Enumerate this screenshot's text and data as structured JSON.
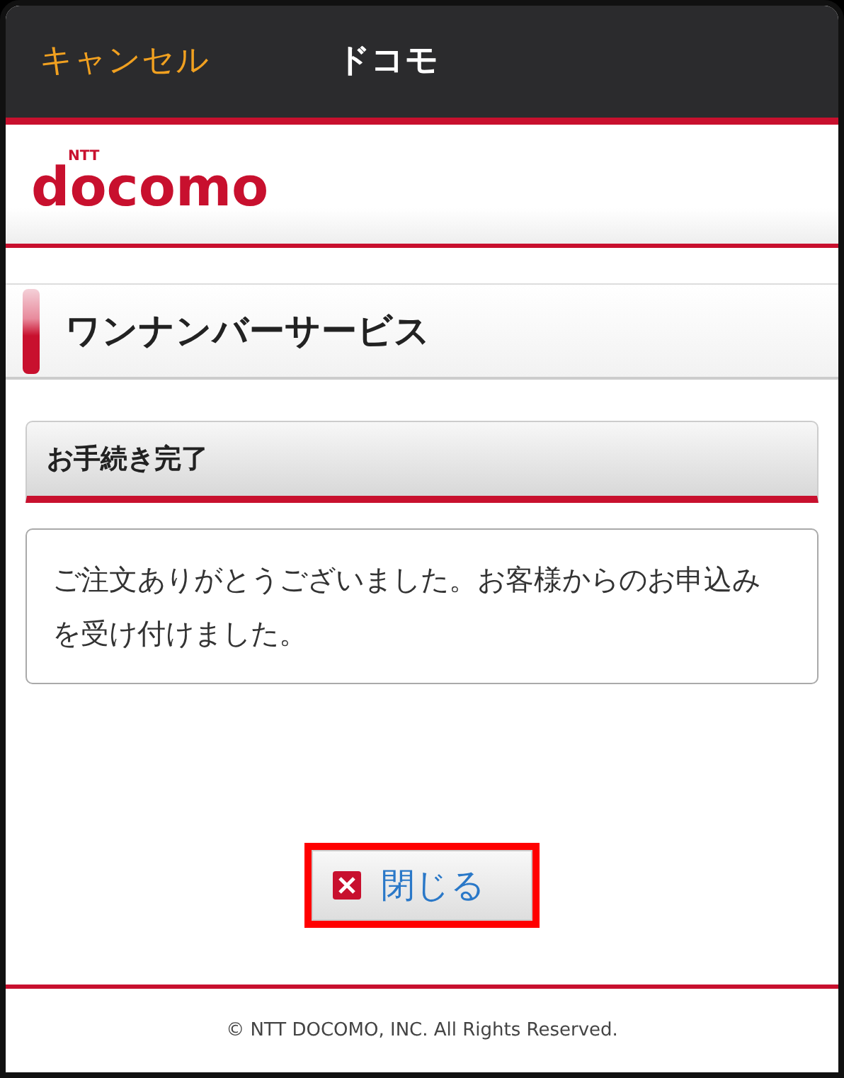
{
  "nav_bar": {
    "cancel": "キャンセル",
    "title": "ドコモ"
  },
  "logo": {
    "small": "NTT",
    "wordmark": "docomo"
  },
  "page_heading": "ワンナンバーサービス",
  "panel": {
    "heading": "お手続き完了",
    "message": "ご注文ありがとうございました。お客様からのお申込みを受け付けました。"
  },
  "close_button": {
    "label": "閉じる",
    "highlighted": true
  },
  "footer": "© NTT DOCOMO, INC. All Rights Reserved."
}
